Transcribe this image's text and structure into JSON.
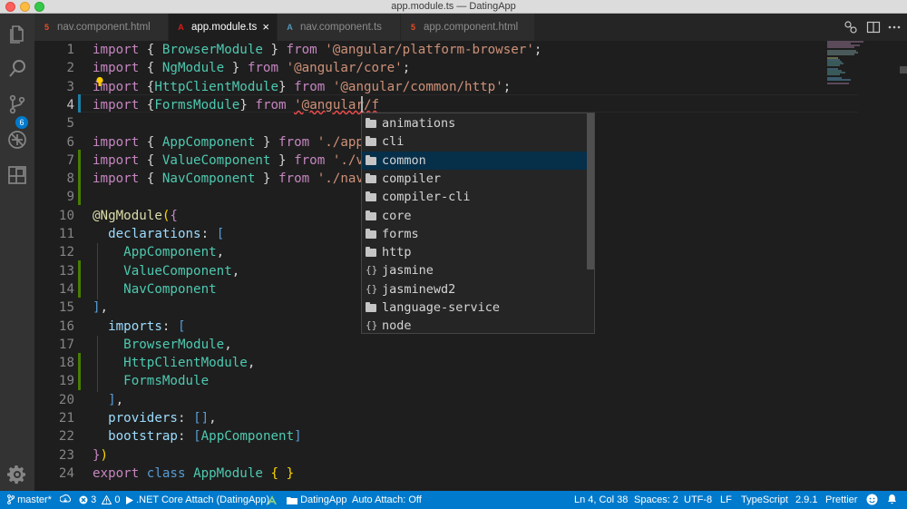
{
  "window": {
    "title": "app.module.ts — DatingApp"
  },
  "activity_bar": {
    "scm_badge": "6"
  },
  "tabs": [
    {
      "label": "nav.component.html",
      "icon": "html-icon",
      "icon_glyph": "5"
    },
    {
      "label": "app.module.ts",
      "icon": "angular-icon",
      "icon_glyph": "A",
      "close": "×"
    },
    {
      "label": "nav.component.ts",
      "icon": "typescript-icon",
      "icon_glyph": "A"
    },
    {
      "label": "app.component.html",
      "icon": "html-icon",
      "icon_glyph": "5"
    }
  ],
  "editor": {
    "lines": [
      {
        "n": "1",
        "tokens": [
          [
            "kw",
            "import"
          ],
          [
            "pn",
            " { "
          ],
          [
            "ty",
            "BrowserModule"
          ],
          [
            "pn",
            " } "
          ],
          [
            "kw",
            "from"
          ],
          [
            "pn",
            " "
          ],
          [
            "str",
            "'@angular/platform-browser'"
          ],
          [
            "pn",
            ";"
          ]
        ]
      },
      {
        "n": "2",
        "tokens": [
          [
            "kw",
            "import"
          ],
          [
            "pn",
            " { "
          ],
          [
            "ty",
            "NgModule"
          ],
          [
            "pn",
            " } "
          ],
          [
            "kw",
            "from"
          ],
          [
            "pn",
            " "
          ],
          [
            "str",
            "'@angular/core'"
          ],
          [
            "pn",
            ";"
          ]
        ]
      },
      {
        "n": "3",
        "tokens": [
          [
            "kw",
            "import"
          ],
          [
            "pn",
            " {"
          ],
          [
            "ty",
            "HttpClientModule"
          ],
          [
            "pn",
            "} "
          ],
          [
            "kw",
            "from"
          ],
          [
            "pn",
            " "
          ],
          [
            "str",
            "'@angular/common/http'"
          ],
          [
            "pn",
            ";"
          ]
        ]
      },
      {
        "n": "4",
        "tokens": [
          [
            "kw",
            "import"
          ],
          [
            "pn",
            " {"
          ],
          [
            "ty",
            "FormsModule"
          ],
          [
            "pn",
            "} "
          ],
          [
            "kw",
            "from"
          ],
          [
            "pn",
            " "
          ],
          [
            "str squiggle",
            "'@angular/f"
          ]
        ]
      },
      {
        "n": "5",
        "tokens": []
      },
      {
        "n": "6",
        "tokens": [
          [
            "kw",
            "import"
          ],
          [
            "pn",
            " { "
          ],
          [
            "ty",
            "AppComponent"
          ],
          [
            "pn",
            " } "
          ],
          [
            "kw",
            "from"
          ],
          [
            "pn",
            " "
          ],
          [
            "str",
            "'./app.c"
          ]
        ]
      },
      {
        "n": "7",
        "tokens": [
          [
            "kw",
            "import"
          ],
          [
            "pn",
            " { "
          ],
          [
            "ty",
            "ValueComponent"
          ],
          [
            "pn",
            " } "
          ],
          [
            "kw",
            "from"
          ],
          [
            "pn",
            " "
          ],
          [
            "str",
            "'./val"
          ]
        ]
      },
      {
        "n": "8",
        "tokens": [
          [
            "kw",
            "import"
          ],
          [
            "pn",
            " { "
          ],
          [
            "ty",
            "NavComponent"
          ],
          [
            "pn",
            " } "
          ],
          [
            "kw",
            "from"
          ],
          [
            "pn",
            " "
          ],
          [
            "str",
            "'./nav/n"
          ]
        ]
      },
      {
        "n": "9",
        "tokens": []
      },
      {
        "n": "10",
        "tokens": [
          [
            "fn",
            "@NgModule"
          ],
          [
            "br1",
            "("
          ],
          [
            "kw",
            "{"
          ]
        ]
      },
      {
        "n": "11",
        "tokens": [
          [
            "pn",
            "  "
          ],
          [
            "var",
            "declarations"
          ],
          [
            "pn",
            ": "
          ],
          [
            "bl",
            "["
          ]
        ]
      },
      {
        "n": "12",
        "tokens": [
          [
            "pn",
            "    "
          ],
          [
            "ty",
            "AppComponent"
          ],
          [
            "pn",
            ","
          ]
        ]
      },
      {
        "n": "13",
        "tokens": [
          [
            "pn",
            "    "
          ],
          [
            "ty",
            "ValueComponent"
          ],
          [
            "pn",
            ","
          ]
        ]
      },
      {
        "n": "14",
        "tokens": [
          [
            "pn",
            "    "
          ],
          [
            "ty",
            "NavComponent"
          ]
        ]
      },
      {
        "n": "15",
        "tokens": [
          [
            "bl",
            "]"
          ],
          [
            "pn",
            ","
          ]
        ]
      },
      {
        "n": "16",
        "tokens": [
          [
            "pn",
            "  "
          ],
          [
            "var",
            "imports"
          ],
          [
            "pn",
            ": "
          ],
          [
            "bl",
            "["
          ]
        ]
      },
      {
        "n": "17",
        "tokens": [
          [
            "pn",
            "    "
          ],
          [
            "ty",
            "BrowserModule"
          ],
          [
            "pn",
            ","
          ]
        ]
      },
      {
        "n": "18",
        "tokens": [
          [
            "pn",
            "    "
          ],
          [
            "ty",
            "HttpClientModule"
          ],
          [
            "pn",
            ","
          ]
        ]
      },
      {
        "n": "19",
        "tokens": [
          [
            "pn",
            "    "
          ],
          [
            "ty",
            "FormsModule"
          ]
        ]
      },
      {
        "n": "20",
        "tokens": [
          [
            "pn",
            "  "
          ],
          [
            "bl",
            "]"
          ],
          [
            "pn",
            ","
          ]
        ]
      },
      {
        "n": "21",
        "tokens": [
          [
            "pn",
            "  "
          ],
          [
            "var",
            "providers"
          ],
          [
            "pn",
            ": "
          ],
          [
            "bl",
            "[]"
          ],
          [
            "pn",
            ","
          ]
        ]
      },
      {
        "n": "22",
        "tokens": [
          [
            "pn",
            "  "
          ],
          [
            "var",
            "bootstrap"
          ],
          [
            "pn",
            ": "
          ],
          [
            "bl",
            "["
          ],
          [
            "ty",
            "AppComponent"
          ],
          [
            "bl",
            "]"
          ]
        ]
      },
      {
        "n": "23",
        "tokens": [
          [
            "kw",
            "}"
          ],
          [
            "br1",
            ")"
          ]
        ]
      },
      {
        "n": "24",
        "tokens": [
          [
            "kw",
            "export"
          ],
          [
            "pn",
            " "
          ],
          [
            "bl",
            "class"
          ],
          [
            "pn",
            " "
          ],
          [
            "ty",
            "AppModule"
          ],
          [
            "pn",
            " "
          ],
          [
            "br1",
            "{ }"
          ]
        ]
      }
    ],
    "current_line": "4"
  },
  "suggestions": {
    "items": [
      {
        "label": "animations",
        "kind": "folder"
      },
      {
        "label": "cli",
        "kind": "folder"
      },
      {
        "label": "common",
        "kind": "folder",
        "selected": true
      },
      {
        "label": "compiler",
        "kind": "folder"
      },
      {
        "label": "compiler-cli",
        "kind": "folder"
      },
      {
        "label": "core",
        "kind": "folder"
      },
      {
        "label": "forms",
        "kind": "folder"
      },
      {
        "label": "http",
        "kind": "folder"
      },
      {
        "label": "jasmine",
        "kind": "object",
        "glyph": "{}"
      },
      {
        "label": "jasminewd2",
        "kind": "object",
        "glyph": "{}"
      },
      {
        "label": "language-service",
        "kind": "folder"
      },
      {
        "label": "node",
        "kind": "object",
        "glyph": "{}"
      }
    ]
  },
  "status_bar": {
    "branch": "master*",
    "errors": "3",
    "warnings": "0",
    "debug_config": ".NET Core Attach (DatingApp)",
    "folder": "DatingApp",
    "auto_attach": "Auto Attach: Off",
    "position": "Ln 4, Col 38",
    "spaces": "Spaces: 2",
    "encoding": "UTF-8",
    "eol": "LF",
    "language": "TypeScript",
    "ts_version": "2.9.1",
    "formatter": "Prettier"
  },
  "colors": {
    "status_bar": "#007acc",
    "keyword": "#c586c0",
    "string": "#ce9178",
    "type": "#4ec9b0",
    "property": "#9cdcfe"
  }
}
